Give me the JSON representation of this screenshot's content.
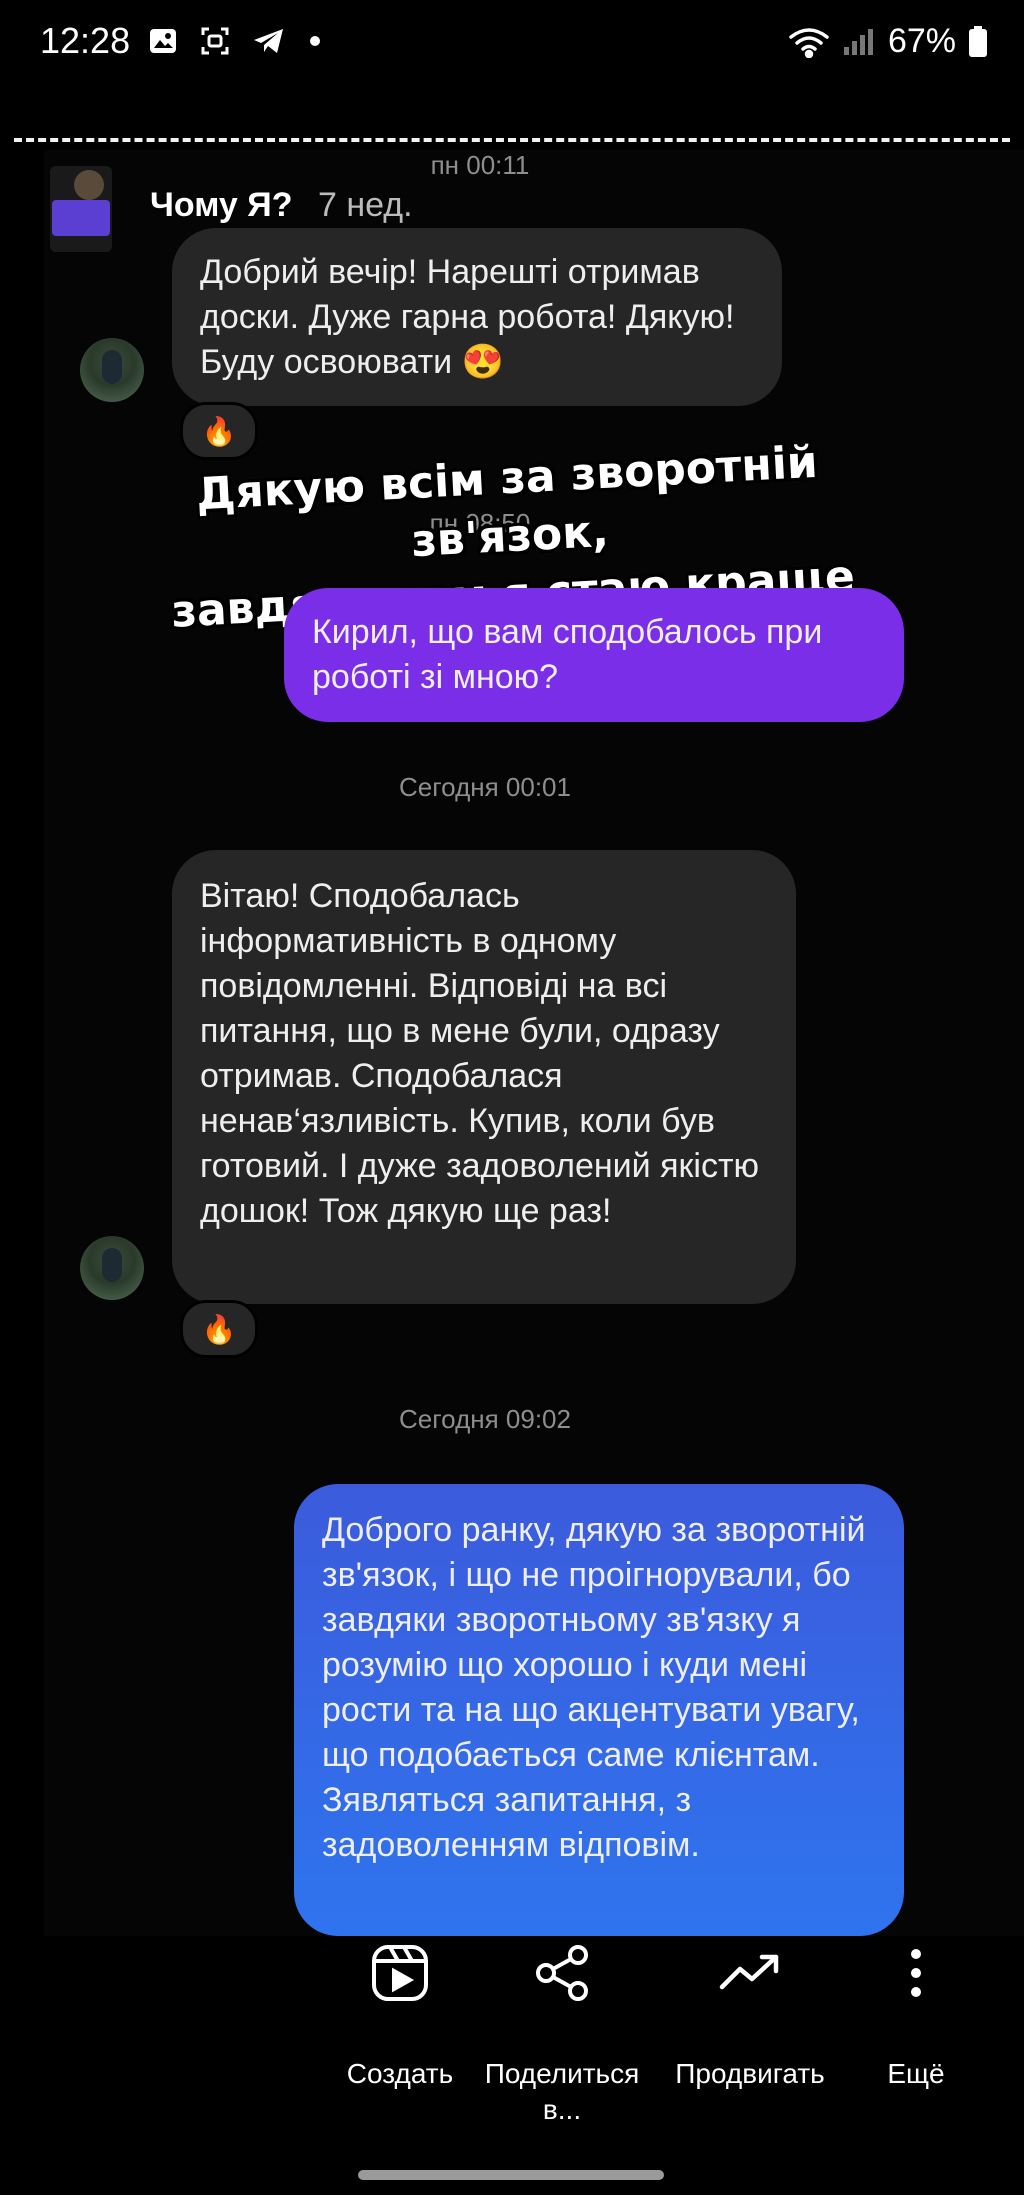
{
  "status_bar": {
    "time": "12:28",
    "battery": "67%",
    "icons": [
      "image-icon",
      "screenshot-icon",
      "telegram-icon",
      "dot-icon",
      "wifi-icon",
      "signal-icon",
      "battery-icon"
    ]
  },
  "chat": {
    "top_timestamp": "пн 00:11",
    "header_name": "Чому Я?",
    "header_time": "7 нед.",
    "messages": [
      {
        "from": "them",
        "text": "Добрий вечір! Нарешті отримав доски. Дуже гарна робота! Дякую! Буду освоювати 😍",
        "reaction": "🔥"
      },
      {
        "from": "me",
        "text": "Кирил, що вам сподобалось при роботі зі мною?"
      },
      {
        "from": "them",
        "text": "Вітаю! Сподобалась інформативність в одному повідомленні. Відповіді на всі питання, що в мене були, одразу отримав. Сподобалася ненав‘язливість. Купив, коли був готовий. І дуже задоволений якістю дошок! Тож дякую ще раз!",
        "reaction": "🔥"
      },
      {
        "from": "me",
        "text": "Доброго ранку, дякую за зворотній зв'язок, і що не проігнорували, бо завдяки зворотньому зв'язку  я розумію що хорошо і куди мені рости та на що акцентувати увагу, що подобається саме клієнтам. Зявляться запитання, з задоволенням відповім."
      }
    ],
    "timestamps": {
      "ts_hidden": "пн 08:50",
      "ts_today_1": "Сегодня 00:01",
      "ts_today_2": "Сегодня 09:02"
    }
  },
  "overlay_text": {
    "line1": "Дякую всім за зворотній зв'язок,",
    "line2": "завдяки вам я стаю краще"
  },
  "actions": [
    {
      "label": "Создать",
      "icon": "reels-icon"
    },
    {
      "label": "Поделиться в...",
      "label_line1": "Поделиться",
      "label_line2": "в...",
      "icon": "share-icon"
    },
    {
      "label": "Продвигать",
      "icon": "promote-icon"
    },
    {
      "label": "Ещё",
      "icon": "more-icon"
    }
  ],
  "colors": {
    "background": "#000000",
    "incoming_bubble": "#262626",
    "purple_bubble": "#7a2ee8",
    "blue_bubble": "#2f74ee"
  }
}
